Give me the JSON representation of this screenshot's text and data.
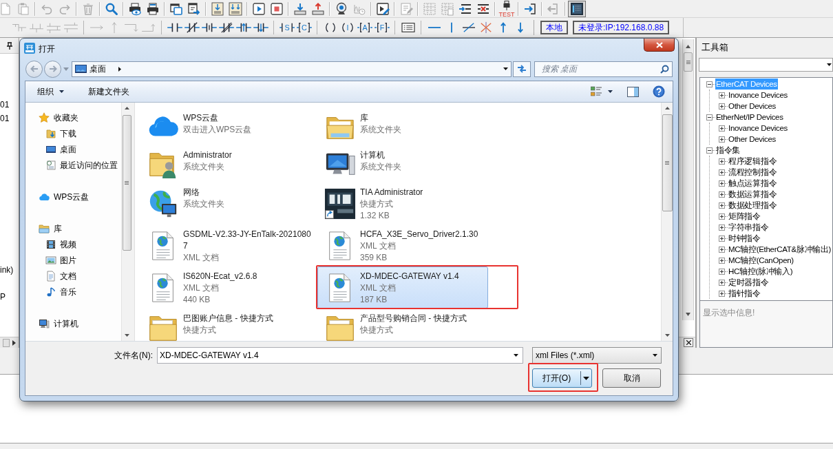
{
  "toolbar": {
    "rows": [
      {
        "groups": [
          [
            {
              "kind": "document",
              "disabled": true,
              "pressed": false
            },
            {
              "kind": "paste",
              "disabled": true,
              "pressed": false
            }
          ],
          [
            {
              "kind": "undo",
              "disabled": true,
              "pressed": false
            },
            {
              "kind": "redo",
              "disabled": true,
              "pressed": false
            }
          ],
          [
            {
              "kind": "delete",
              "disabled": true,
              "pressed": false
            }
          ],
          [
            {
              "kind": "find",
              "disabled": false,
              "pressed": false
            }
          ],
          [
            {
              "kind": "print-preview",
              "disabled": false,
              "pressed": false
            },
            {
              "kind": "print",
              "disabled": false,
              "pressed": false
            }
          ],
          [
            {
              "kind": "windows",
              "disabled": false,
              "pressed": false
            },
            {
              "kind": "export",
              "disabled": false,
              "pressed": false
            }
          ],
          [
            {
              "kind": "download-program",
              "disabled": false,
              "pressed": false
            },
            {
              "kind": "download-all",
              "disabled": false,
              "pressed": false
            }
          ],
          [
            {
              "kind": "run",
              "disabled": false,
              "pressed": false
            },
            {
              "kind": "stop",
              "disabled": false,
              "pressed": false
            }
          ],
          [
            {
              "kind": "download",
              "disabled": false,
              "pressed": false
            },
            {
              "kind": "upload",
              "disabled": false,
              "pressed": false
            }
          ],
          [
            {
              "kind": "monitor",
              "disabled": false,
              "pressed": false
            },
            {
              "kind": "trend",
              "disabled": true,
              "pressed": false
            }
          ],
          [
            {
              "kind": "edit-run",
              "disabled": false,
              "pressed": false
            }
          ],
          [
            {
              "kind": "note",
              "disabled": true,
              "pressed": false
            }
          ],
          [
            {
              "kind": "grid",
              "disabled": true,
              "pressed": false
            },
            {
              "kind": "grid-delete",
              "disabled": true,
              "pressed": false
            },
            {
              "kind": "insert-row",
              "disabled": false,
              "pressed": false
            },
            {
              "kind": "delete-row",
              "disabled": false,
              "pressed": false
            }
          ],
          [
            {
              "kind": "test",
              "label": "TEST",
              "disabled": false,
              "pressed": false
            }
          ],
          [
            {
              "kind": "login",
              "disabled": false,
              "pressed": false
            }
          ],
          [
            {
              "kind": "logout",
              "disabled": true,
              "pressed": false
            }
          ],
          [
            {
              "kind": "panel",
              "disabled": false,
              "pressed": true
            }
          ]
        ]
      },
      {
        "groups": [
          [
            {
              "kind": "ladder-a",
              "disabled": true,
              "pressed": false
            },
            {
              "kind": "ladder-b",
              "disabled": true,
              "pressed": false
            },
            {
              "kind": "ladder-c",
              "disabled": true,
              "pressed": false
            },
            {
              "kind": "ladder-d",
              "disabled": true,
              "pressed": false
            }
          ],
          [
            {
              "kind": "line-right",
              "disabled": true,
              "pressed": false
            },
            {
              "kind": "line-up",
              "disabled": true,
              "pressed": false
            },
            {
              "kind": "corner-down",
              "disabled": true,
              "pressed": false
            },
            {
              "kind": "corner-up",
              "disabled": true,
              "pressed": false
            }
          ],
          [
            {
              "kind": "contact-no",
              "disabled": false,
              "pressed": false
            },
            {
              "kind": "contact-nc",
              "disabled": false,
              "pressed": false
            },
            {
              "kind": "contact-mid",
              "disabled": false,
              "pressed": false
            },
            {
              "kind": "contact-nc2",
              "disabled": false,
              "pressed": false
            },
            {
              "kind": "edge-rise",
              "disabled": false,
              "pressed": false
            },
            {
              "kind": "edge-fall",
              "disabled": false,
              "pressed": false
            }
          ],
          [
            {
              "kind": "set",
              "label": "S",
              "disabled": false,
              "pressed": false
            },
            {
              "kind": "compare",
              "label": "C",
              "disabled": false,
              "pressed": false
            }
          ],
          [
            {
              "kind": "coil",
              "disabled": false,
              "pressed": false
            },
            {
              "kind": "coil-label",
              "label": "I",
              "disabled": false,
              "pressed": false
            },
            {
              "kind": "box",
              "label": "A",
              "disabled": false,
              "pressed": false
            },
            {
              "kind": "box",
              "label": "F",
              "disabled": false,
              "pressed": false
            }
          ],
          [
            {
              "kind": "table",
              "disabled": false,
              "pressed": false
            }
          ],
          [
            {
              "kind": "hline",
              "disabled": false,
              "pressed": false
            },
            {
              "kind": "vline",
              "disabled": false,
              "pressed": false
            },
            {
              "kind": "diag",
              "disabled": false,
              "pressed": false
            },
            {
              "kind": "cross",
              "disabled": false,
              "pressed": false
            },
            {
              "kind": "up",
              "disabled": false,
              "pressed": false
            },
            {
              "kind": "down",
              "disabled": false,
              "pressed": false
            }
          ]
        ]
      }
    ]
  },
  "connection_buttons": [
    {
      "label": "本地"
    },
    {
      "label": "未登录:IP:192.168.0.88"
    }
  ],
  "left_panel": {
    "lines": [
      "01",
      "01",
      "ink)",
      "P"
    ]
  },
  "dialog": {
    "title": "打开",
    "address": {
      "location": "桌面"
    },
    "search": {
      "placeholder": "搜索 桌面"
    },
    "commands": [
      {
        "label": "组织",
        "menu": true
      },
      {
        "label": "新建文件夹",
        "menu": false
      }
    ],
    "nav": [
      {
        "label": "收藏夹",
        "kind": "favorites",
        "children": [
          {
            "label": "下载",
            "kind": "downloads"
          },
          {
            "label": "桌面",
            "kind": "desktop"
          },
          {
            "label": "最近访问的位置",
            "kind": "recent"
          }
        ]
      },
      {
        "label": "WPS云盘",
        "kind": "cloud"
      },
      {
        "label": "库",
        "kind": "library",
        "children": [
          {
            "label": "视频",
            "kind": "videos"
          },
          {
            "label": "图片",
            "kind": "pictures"
          },
          {
            "label": "文档",
            "kind": "documents"
          },
          {
            "label": "音乐",
            "kind": "music"
          }
        ]
      },
      {
        "label": "计算机",
        "kind": "computer"
      }
    ],
    "files": [
      {
        "name": "WPS云盘",
        "kind": "cloud",
        "details": [
          "双击进入WPS云盘"
        ],
        "selected": false,
        "highlighted": false
      },
      {
        "name": "库",
        "kind": "library",
        "details": [
          "系统文件夹"
        ],
        "selected": false,
        "highlighted": false
      },
      {
        "name": "Administrator",
        "kind": "user-folder",
        "details": [
          "系统文件夹"
        ],
        "selected": false,
        "highlighted": false
      },
      {
        "name": "计算机",
        "kind": "computer",
        "details": [
          "系统文件夹"
        ],
        "selected": false,
        "highlighted": false
      },
      {
        "name": "网络",
        "kind": "network",
        "details": [
          "系统文件夹"
        ],
        "selected": false,
        "highlighted": false
      },
      {
        "name": "TIA Administrator",
        "kind": "shortcut",
        "details": [
          "快捷方式",
          "1.32 KB"
        ],
        "selected": false,
        "highlighted": false
      },
      {
        "name": "GSDML-V2.33-JY-EnTalk-20210807",
        "kind": "xml",
        "details": [
          "XML 文档"
        ],
        "selected": false,
        "highlighted": false
      },
      {
        "name": "HCFA_X3E_Servo_Driver2.1.30",
        "kind": "xml",
        "details": [
          "XML 文档",
          "359 KB"
        ],
        "selected": false,
        "highlighted": false
      },
      {
        "name": "IS620N-Ecat_v2.6.8",
        "kind": "xml",
        "details": [
          "XML 文档",
          "440 KB"
        ],
        "selected": false,
        "highlighted": false
      },
      {
        "name": "XD-MDEC-GATEWAY v1.4",
        "kind": "xml",
        "details": [
          "XML 文档",
          "187 KB"
        ],
        "selected": true,
        "highlighted": true
      },
      {
        "name": "巴图账户信息 - 快捷方式",
        "kind": "folder",
        "details": [
          "快捷方式"
        ],
        "selected": false,
        "highlighted": false
      },
      {
        "name": "产品型号购销合同 - 快捷方式",
        "kind": "folder",
        "details": [
          "快捷方式"
        ],
        "selected": false,
        "highlighted": false
      }
    ],
    "file_name": {
      "label": "文件名(N):",
      "value": "XD-MDEC-GATEWAY v1.4"
    },
    "file_type": {
      "value": "xml Files (*.xml)"
    },
    "buttons": [
      {
        "label": "打开(O)",
        "kind": "split",
        "default": true,
        "highlighted": true
      },
      {
        "label": "取消",
        "kind": "plain",
        "default": false,
        "highlighted": false
      }
    ]
  },
  "toolbox": {
    "title": "工具箱",
    "tree": [
      {
        "label": "EtherCAT Devices",
        "expanded": true,
        "selected": true,
        "children": [
          {
            "label": "Inovance Devices",
            "expanded": false,
            "selected": false
          },
          {
            "label": "Other Devices",
            "expanded": false,
            "selected": false
          }
        ]
      },
      {
        "label": "EtherNet/IP Devices",
        "expanded": true,
        "selected": false,
        "children": [
          {
            "label": "Inovance Devices",
            "expanded": false,
            "selected": false
          },
          {
            "label": "Other Devices",
            "expanded": false,
            "selected": false
          }
        ]
      },
      {
        "label": "指令集",
        "expanded": true,
        "selected": false,
        "children": [
          {
            "label": "程序逻辑指令",
            "expanded": false,
            "selected": false
          },
          {
            "label": "流程控制指令",
            "expanded": false,
            "selected": false
          },
          {
            "label": "触点运算指令",
            "expanded": false,
            "selected": false
          },
          {
            "label": "数据运算指令",
            "expanded": false,
            "selected": false
          },
          {
            "label": "数据处理指令",
            "expanded": false,
            "selected": false
          },
          {
            "label": "矩阵指令",
            "expanded": false,
            "selected": false
          },
          {
            "label": "字符串指令",
            "expanded": false,
            "selected": false
          },
          {
            "label": "时钟指令",
            "expanded": false,
            "selected": false
          },
          {
            "label": "MC轴控(EtherCAT&脉冲输出)",
            "expanded": false,
            "selected": false
          },
          {
            "label": "MC轴控(CanOpen)",
            "expanded": false,
            "selected": false
          },
          {
            "label": "HC轴控(脉冲输入)",
            "expanded": false,
            "selected": false
          },
          {
            "label": "定时器指令",
            "expanded": false,
            "selected": false
          },
          {
            "label": "指针指令",
            "expanded": false,
            "selected": false
          }
        ]
      }
    ],
    "info": "显示选中信息!"
  }
}
